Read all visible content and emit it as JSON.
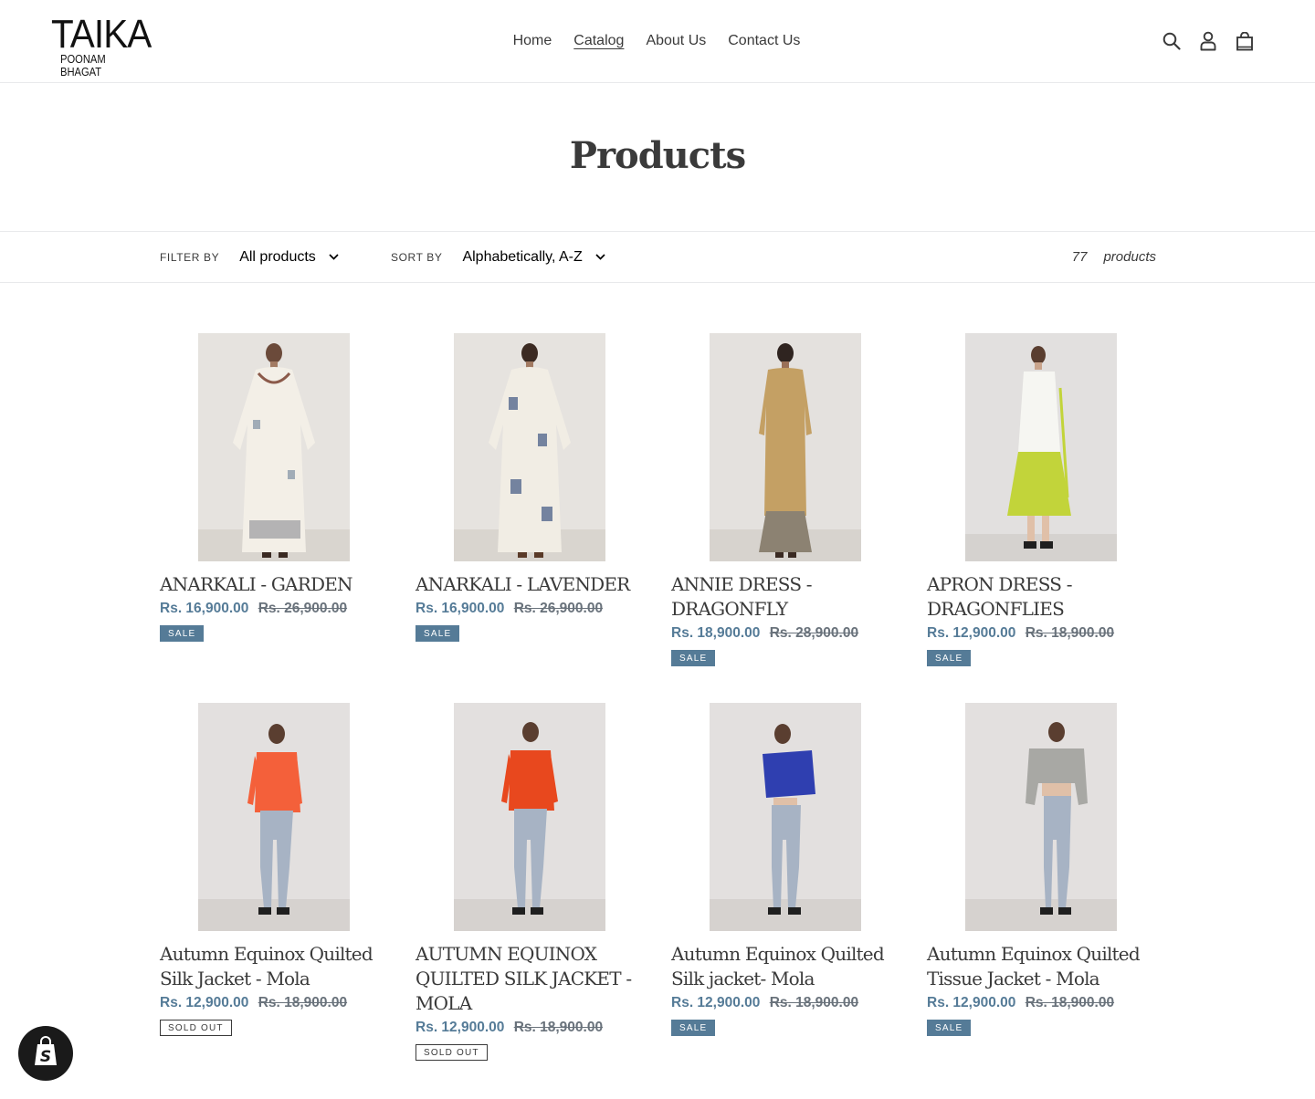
{
  "header": {
    "logo_main": "TAIKA",
    "logo_sub": "POONAM BHAGAT",
    "nav": [
      {
        "label": "Home",
        "active": false
      },
      {
        "label": "Catalog",
        "active": true
      },
      {
        "label": "About Us",
        "active": false
      },
      {
        "label": "Contact Us",
        "active": false
      }
    ],
    "icons": [
      "search-icon",
      "account-icon",
      "cart-icon"
    ]
  },
  "page": {
    "title": "Products"
  },
  "filters": {
    "filter_label": "FILTER BY",
    "filter_value": "All products",
    "sort_label": "SORT BY",
    "sort_value": "Alphabetically, A-Z",
    "count": "77",
    "count_label": "products"
  },
  "products": [
    {
      "name": "ANARKALI - GARDEN",
      "price": "Rs. 16,900.00",
      "compare_price": "Rs. 26,900.00",
      "badge": "SALE",
      "badge_type": "sale"
    },
    {
      "name": "ANARKALI - LAVENDER",
      "price": "Rs. 16,900.00",
      "compare_price": "Rs. 26,900.00",
      "badge": "SALE",
      "badge_type": "sale"
    },
    {
      "name": "ANNIE DRESS - DRAGONFLY",
      "price": "Rs. 18,900.00",
      "compare_price": "Rs. 28,900.00",
      "badge": "SALE",
      "badge_type": "sale"
    },
    {
      "name": "APRON DRESS - DRAGONFLIES",
      "price": "Rs. 12,900.00",
      "compare_price": "Rs. 18,900.00",
      "badge": "SALE",
      "badge_type": "sale"
    },
    {
      "name": "Autumn Equinox Quilted Silk Jacket - Mola",
      "price": "Rs. 12,900.00",
      "compare_price": "Rs. 18,900.00",
      "badge": "SOLD OUT",
      "badge_type": "soldout"
    },
    {
      "name": "AUTUMN EQUINOX QUILTED SILK JACKET - MOLA",
      "price": "Rs. 12,900.00",
      "compare_price": "Rs. 18,900.00",
      "badge": "SOLD OUT",
      "badge_type": "soldout"
    },
    {
      "name": "Autumn Equinox Quilted Silk jacket- Mola",
      "price": "Rs. 12,900.00",
      "compare_price": "Rs. 18,900.00",
      "badge": "SALE",
      "badge_type": "sale"
    },
    {
      "name": "Autumn Equinox Quilted Tissue Jacket - Mola",
      "price": "Rs. 12,900.00",
      "compare_price": "Rs. 18,900.00",
      "badge": "SALE",
      "badge_type": "sale"
    }
  ],
  "colors": {
    "accent": "#557b97",
    "text": "#3a3a3a",
    "muted": "#69727b",
    "border": "#e8e9eb"
  }
}
